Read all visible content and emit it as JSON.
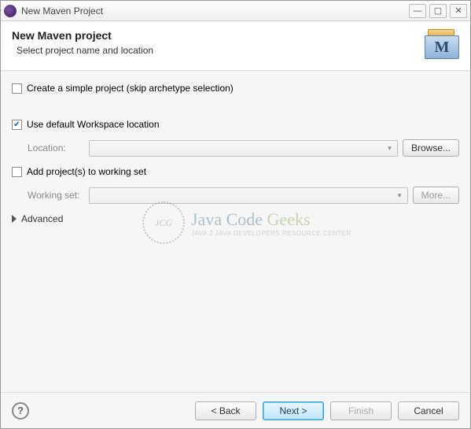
{
  "titlebar": {
    "title": "New Maven Project"
  },
  "header": {
    "heading": "New Maven project",
    "subheading": "Select project name and location",
    "icon_letter": "M"
  },
  "options": {
    "simple_project": {
      "label": "Create a simple project (skip archetype selection)",
      "checked": false
    },
    "use_default_workspace": {
      "label": "Use default Workspace location",
      "checked": true
    },
    "location": {
      "label": "Location:",
      "value": "",
      "browse_label": "Browse..."
    },
    "add_workingset": {
      "label": "Add project(s) to working set",
      "checked": false
    },
    "working_set": {
      "label": "Working set:",
      "value": "",
      "more_label": "More..."
    },
    "advanced_label": "Advanced"
  },
  "watermark": {
    "badge": "JCG",
    "line1_java": "Java",
    "line1_code": "Code",
    "line1_geeks": "Geeks",
    "line2": "Java 2 Java Developers Resource Center"
  },
  "buttons": {
    "help": "?",
    "back": "< Back",
    "next": "Next >",
    "finish": "Finish",
    "cancel": "Cancel"
  }
}
